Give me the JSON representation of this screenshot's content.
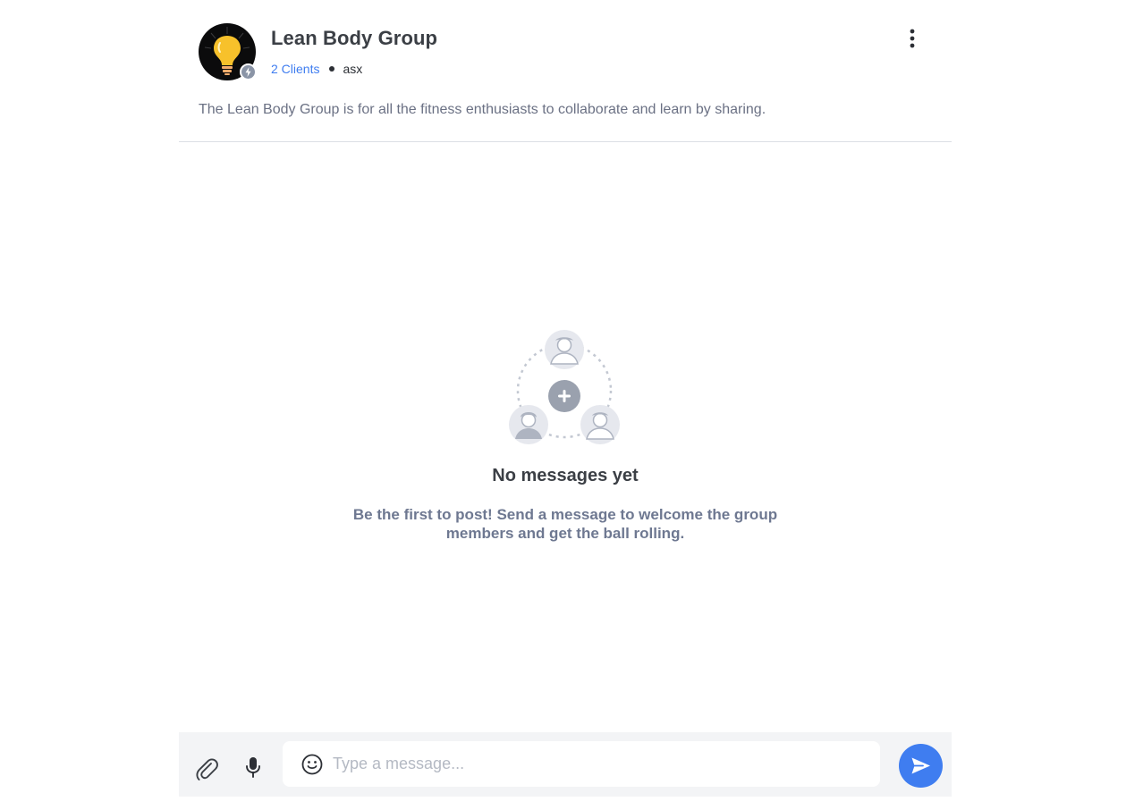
{
  "group": {
    "name": "Lean Body Group",
    "clients": "2 Clients",
    "owner": "asx",
    "description": "The Lean Body Group is for all the fitness enthusiasts to collaborate and learn by sharing."
  },
  "icons": {
    "avatar": "lightbulb-icon",
    "badge": "lightning-bolt-icon",
    "menu": "more-vertical-icon",
    "illustration": "group-members-plus-icon",
    "attach": "paperclip-icon",
    "mic": "microphone-icon",
    "emoji": "smiley-icon",
    "send": "send-arrow-icon"
  },
  "empty_state": {
    "title": "No messages yet",
    "subtitle": "Be the first to post! Send a message to welcome the group members and get the ball rolling."
  },
  "composer": {
    "placeholder": "Type a message..."
  },
  "colors": {
    "accent": "#3f7df0",
    "text_primary": "#3b3f45",
    "text_secondary": "#6e7891",
    "composer_bg": "#f3f4f6"
  }
}
